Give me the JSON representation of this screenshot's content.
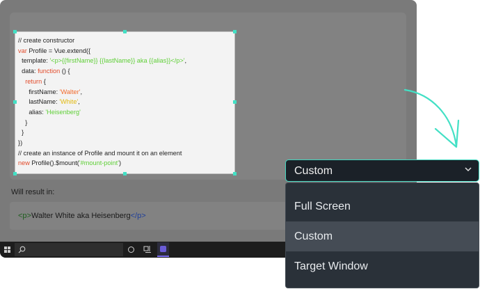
{
  "code_capture": {
    "lines": [
      [
        {
          "t": "// create constructor",
          "c": "plain"
        }
      ],
      [
        {
          "t": "var",
          "c": "kw"
        },
        {
          "t": " Profile = Vue.extend({",
          "c": "plain"
        }
      ],
      [
        {
          "t": "  template: ",
          "c": "plain"
        },
        {
          "t": "'<p>{{firstName}} {{lastName}} aka {{alias}}</p>'",
          "c": "str"
        },
        {
          "t": ",",
          "c": "plain"
        }
      ],
      [
        {
          "t": "  data: ",
          "c": "plain"
        },
        {
          "t": "function",
          "c": "kw"
        },
        {
          "t": " () {",
          "c": "plain"
        }
      ],
      [
        {
          "t": "    ",
          "c": "plain"
        },
        {
          "t": "return",
          "c": "kw"
        },
        {
          "t": " {",
          "c": "plain"
        }
      ],
      [
        {
          "t": "      firstName: ",
          "c": "plain"
        },
        {
          "t": "'Walter'",
          "c": "str-o"
        },
        {
          "t": ",",
          "c": "plain"
        }
      ],
      [
        {
          "t": "      lastName: ",
          "c": "plain"
        },
        {
          "t": "'White'",
          "c": "str-y"
        },
        {
          "t": ",",
          "c": "plain"
        }
      ],
      [
        {
          "t": "      alias: ",
          "c": "plain"
        },
        {
          "t": "'Heisenberg'",
          "c": "str"
        }
      ],
      [
        {
          "t": "    }",
          "c": "plain"
        }
      ],
      [
        {
          "t": "  }",
          "c": "plain"
        }
      ],
      [
        {
          "t": "})",
          "c": "plain"
        }
      ],
      [
        {
          "t": "// create an instance of Profile and mount it on an element",
          "c": "plain"
        }
      ],
      [
        {
          "t": "new",
          "c": "kw"
        },
        {
          "t": " Profile().$mount(",
          "c": "plain"
        },
        {
          "t": "'#mount-point'",
          "c": "str"
        },
        {
          "t": ")",
          "c": "plain"
        }
      ]
    ]
  },
  "result": {
    "label": "Will result in:",
    "open_tag": "<p>",
    "text": "Walter White aka Heisenberg",
    "close_tag": "</p>"
  },
  "dropdown": {
    "selected": "Custom",
    "options": [
      {
        "label": "Full Screen",
        "selected": false
      },
      {
        "label": "Custom",
        "selected": true
      },
      {
        "label": "Target Window",
        "selected": false
      }
    ]
  },
  "taskbar": {
    "icons": [
      "windows-start-icon",
      "search-icon",
      "cortana-icon",
      "task-view-icon",
      "app-icon"
    ]
  },
  "colors": {
    "accent": "#43e0c5",
    "dropdown_bg": "#1b2128",
    "menu_bg": "#2a3139",
    "menu_selected_bg": "#454c55",
    "screen_bg": "#7a7a7a"
  }
}
